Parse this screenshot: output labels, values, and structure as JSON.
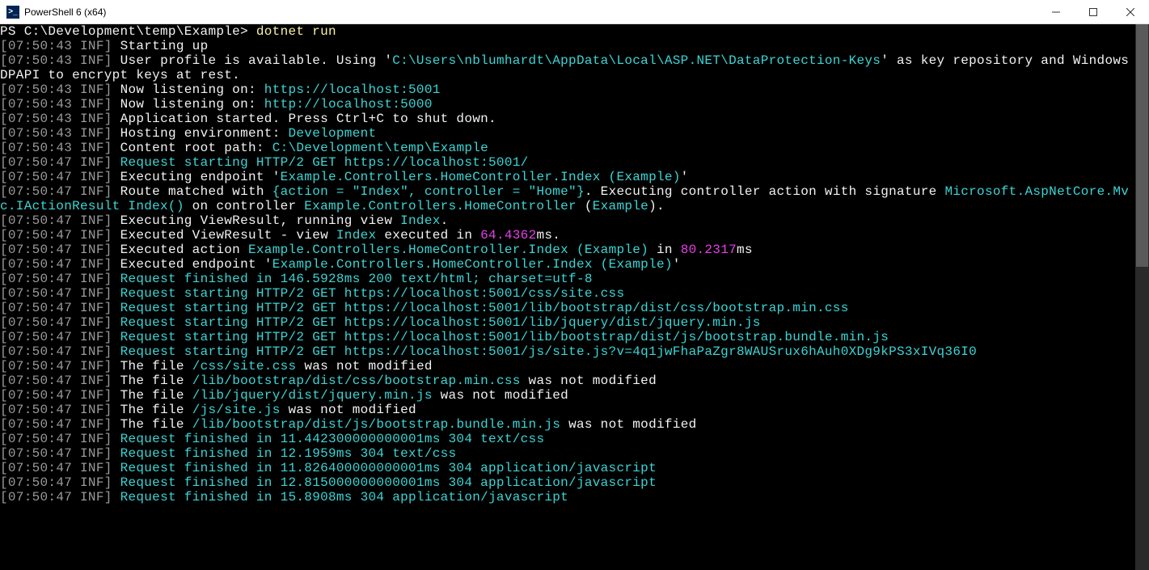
{
  "window": {
    "title": "PowerShell 6 (x64)",
    "icon_glyph": ">_"
  },
  "prompt": {
    "text": "PS C:\\Development\\temp\\Example> ",
    "command": "dotnet run"
  },
  "ts": {
    "t1": "07:50:43",
    "t2": "07:50:47"
  },
  "level": "INF",
  "text": {
    "starting": "Starting up",
    "profile_pre": "User profile is available. Using '",
    "profile_path": "C:\\Users\\nblumhardt\\AppData\\Local\\ASP.NET\\DataProtection-Keys",
    "profile_post": "' as key repository and Windows DPAPI to encrypt keys at rest.",
    "listen_pre": "Now listening on: ",
    "listen_https": "https://localhost:5001",
    "listen_http": "http://localhost:5000",
    "app_started": "Application started. Press Ctrl+C to shut down.",
    "hosting_pre": "Hosting environment: ",
    "hosting_env": "Development",
    "croot_pre": "Content root path: ",
    "croot_path": "C:\\Development\\temp\\Example",
    "req_start_root": "Request starting HTTP/2 GET https://localhost:5001/  ",
    "exec_ep_pre": "Executing endpoint '",
    "exec_ep_name": "Example.Controllers.HomeController.Index (Example)",
    "route_pre": "Route matched with ",
    "route_tokens": "{action = \"Index\", controller = \"Home\"}",
    "route_mid": ". Executing controller action with signature ",
    "route_sig": "Microsoft.AspNetCore.Mvc.IActionResult Index()",
    "route_on": " on controller ",
    "route_ctrl": "Example.Controllers.HomeController",
    "route_paren_open": " (",
    "route_app": "Example",
    "route_paren_close": ").",
    "exec_view_pre": "Executing ViewResult, running view ",
    "view_name": "Index",
    "execd_view_pre": "Executed ViewResult - view ",
    "execd_view_mid": " executed in ",
    "dur_view": "64.4362",
    "ms": "ms.",
    "execd_action_pre": "Executed action ",
    "execd_action_name": "Example.Controllers.HomeController.Index (Example)",
    "in": " in ",
    "dur_action": "80.2317",
    "ms2": "ms",
    "execd_ep_pre": "Executed endpoint '",
    "req_fin_root": "Request finished in 146.5928ms 200 text/html; charset=utf-8",
    "req_css": "Request starting HTTP/2 GET https://localhost:5001/css/site.css  ",
    "req_bscss": "Request starting HTTP/2 GET https://localhost:5001/lib/bootstrap/dist/css/bootstrap.min.css  ",
    "req_jq": "Request starting HTTP/2 GET https://localhost:5001/lib/jquery/dist/jquery.min.js  ",
    "req_bsjs": "Request starting HTTP/2 GET https://localhost:5001/lib/bootstrap/dist/js/bootstrap.bundle.min.js  ",
    "req_sitejs": "Request starting HTTP/2 GET https://localhost:5001/js/site.js?v=4q1jwFhaPaZgr8WAUSrux6hAuh0XDg9kPS3xIVq36I0  ",
    "file_pre": "The file ",
    "file_css": "/css/site.css",
    "file_bscss": "/lib/bootstrap/dist/css/bootstrap.min.css",
    "file_jq": "/lib/jquery/dist/jquery.min.js",
    "file_sitejs": "/js/site.js",
    "file_bsjs": "/lib/bootstrap/dist/js/bootstrap.bundle.min.js",
    "not_modified": " was not modified",
    "fin1": "Request finished in 11.442300000000001ms 304 text/css",
    "fin2": "Request finished in 12.1959ms 304 text/css",
    "fin3": "Request finished in 11.826400000000001ms 304 application/javascript",
    "fin4": "Request finished in 12.815000000000001ms 304 application/javascript",
    "fin5": "Request finished in 15.8908ms 304 application/javascript"
  }
}
